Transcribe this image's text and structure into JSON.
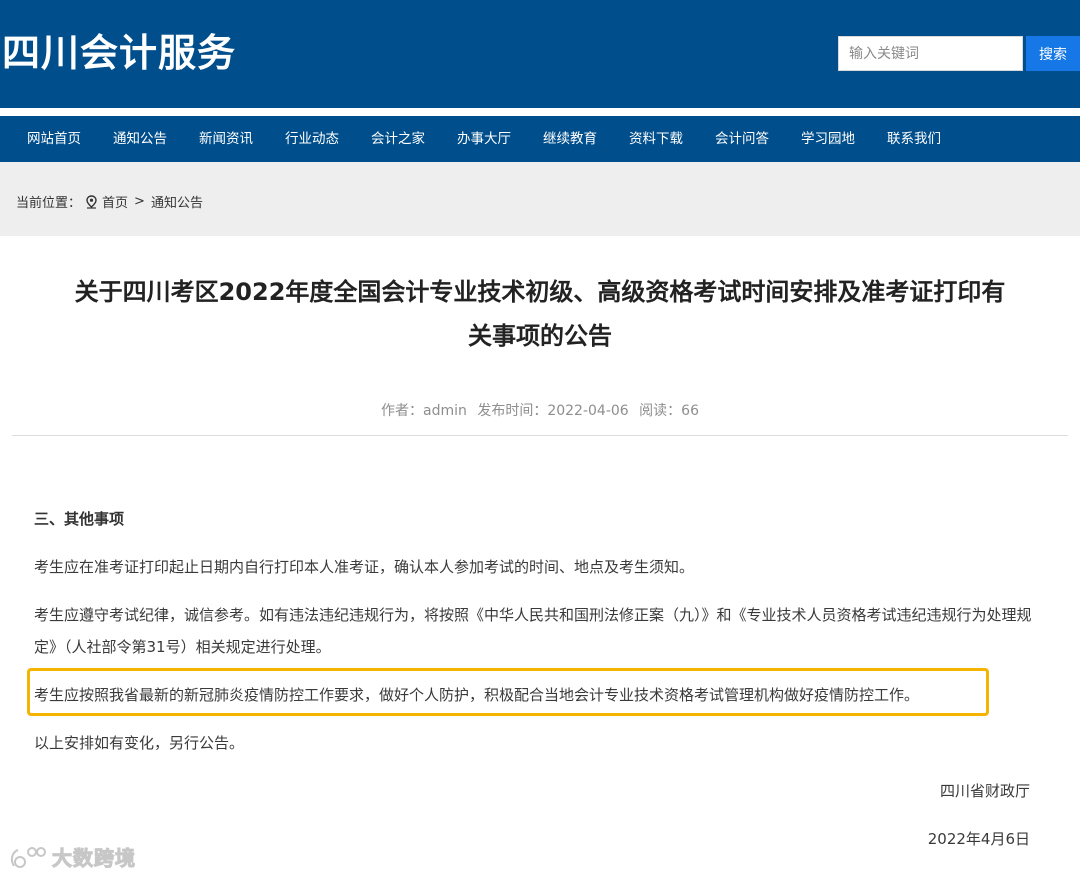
{
  "header": {
    "site_title": "四川会计服务",
    "search": {
      "placeholder": "输入关键词",
      "button_label": "搜索"
    },
    "colors": {
      "header_bg": "#004e8c",
      "search_button": "#1677e6"
    }
  },
  "nav": {
    "items": [
      {
        "label": "网站首页"
      },
      {
        "label": "通知公告"
      },
      {
        "label": "新闻资讯"
      },
      {
        "label": "行业动态"
      },
      {
        "label": "会计之家"
      },
      {
        "label": "办事大厅"
      },
      {
        "label": "继续教育"
      },
      {
        "label": "资料下载"
      },
      {
        "label": "会计问答"
      },
      {
        "label": "学习园地"
      },
      {
        "label": "联系我们"
      }
    ]
  },
  "breadcrumb": {
    "prefix": "当前位置：",
    "icon": "location-pin-icon",
    "home": "首页",
    "separator": ">",
    "current": "通知公告"
  },
  "article": {
    "title_line1": "关于四川考区2022年度全国会计专业技术初级、高级资格考试时间安排及准考证打印有",
    "title_line2": "关事项的公告",
    "meta": {
      "author_label": "作者：",
      "author": "admin",
      "date_label": "发布时间：",
      "date": "2022-04-06",
      "views_label": "阅读：",
      "views": "66"
    },
    "section_heading": "三、其他事项",
    "paragraphs": [
      "考生应在准考证打印起止日期内自行打印本人准考证，确认本人参加考试的时间、地点及考生须知。",
      "考生应遵守考试纪律，诚信参考。如有违法违纪违规行为，将按照《中华人民共和国刑法修正案（九）》和《专业技术人员资格考试违纪违规行为处理规定》（人社部令第31号）相关规定进行处理。",
      "考生应按照我省最新的新冠肺炎疫情防控工作要求，做好个人防护，积极配合当地会计专业技术资格考试管理机构做好疫情防控工作。",
      "以上安排如有变化，另行公告。"
    ],
    "signature_org": "四川省财政厅",
    "signature_date": "2022年4月6日",
    "highlight_color": "#f5b400"
  },
  "watermark": {
    "text": "大数跨境",
    "icon": "watermark-logo-icon"
  }
}
